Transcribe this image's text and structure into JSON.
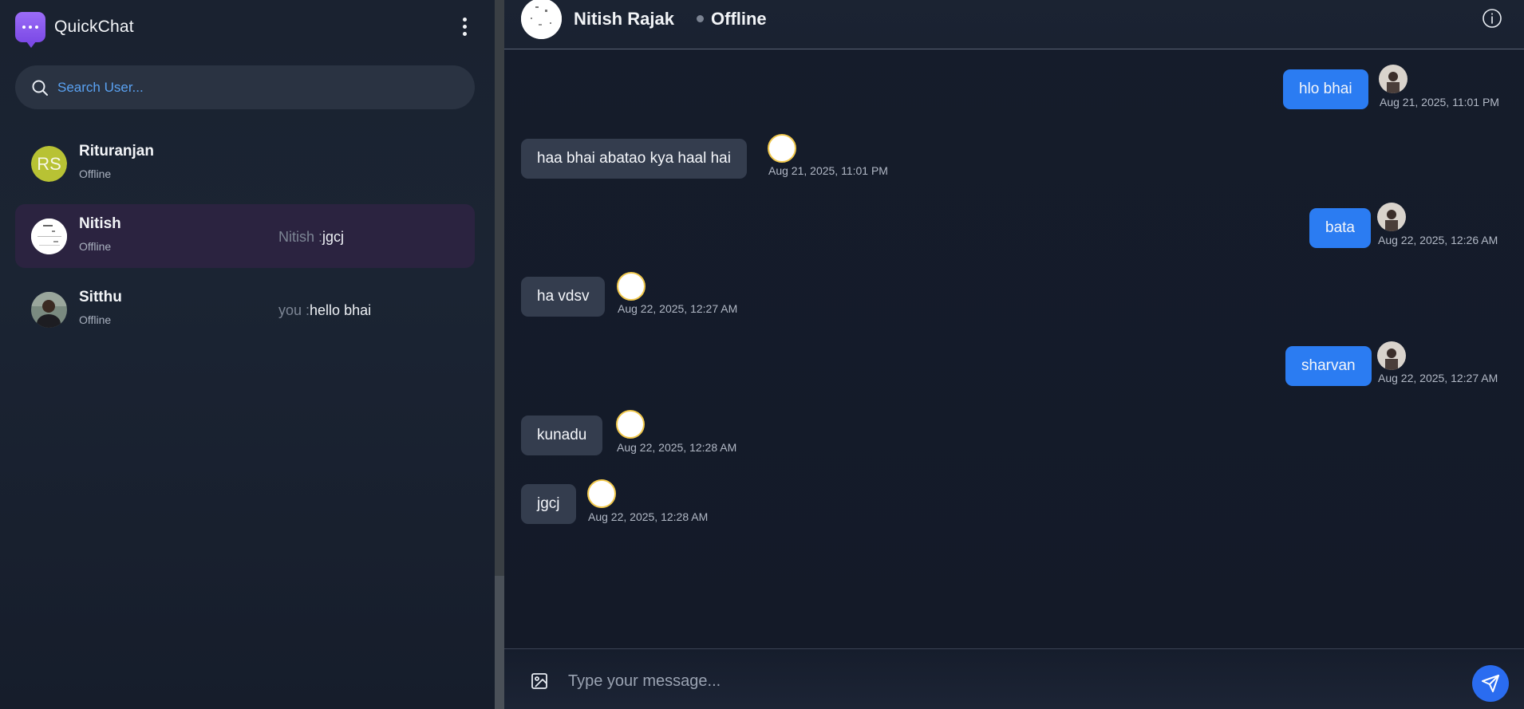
{
  "app": {
    "name": "QuickChat"
  },
  "search": {
    "placeholder": "Search User..."
  },
  "users": [
    {
      "name": "Rituranjan",
      "initials": "RS",
      "status": "Offline",
      "last_from": "",
      "last_msg": ""
    },
    {
      "name": "Nitish",
      "status": "Offline",
      "last_from": "Nitish :",
      "last_msg": "jgcj"
    },
    {
      "name": "Sitthu",
      "status": "Offline",
      "last_from": "you :",
      "last_msg": "hello bhai"
    }
  ],
  "chat": {
    "contact_name": "Nitish Rajak",
    "contact_status": "Offline",
    "messages": [
      {
        "direction": "out",
        "text": "hlo bhai",
        "time": "Aug 21, 2025, 11:01 PM"
      },
      {
        "direction": "in",
        "text": "haa bhai abatao kya haal hai",
        "time": "Aug 21, 2025, 11:01 PM"
      },
      {
        "direction": "out",
        "text": "bata",
        "time": "Aug 22, 2025, 12:26 AM"
      },
      {
        "direction": "in",
        "text": "ha vdsv",
        "time": "Aug 22, 2025, 12:27 AM"
      },
      {
        "direction": "out",
        "text": "sharvan",
        "time": "Aug 22, 2025, 12:27 AM"
      },
      {
        "direction": "in",
        "text": "kunadu",
        "time": "Aug 22, 2025, 12:28 AM"
      },
      {
        "direction": "in",
        "text": "jgcj",
        "time": "Aug 22, 2025, 12:28 AM"
      }
    ]
  },
  "composer": {
    "placeholder": "Type your message..."
  },
  "colors": {
    "accent": "#2b7cf2",
    "brand": "#8b5cf6",
    "sidebar_active": "#2b2340",
    "incoming_bubble": "#343d4e"
  },
  "icons": [
    "chat-bubble-logo-icon",
    "more-vertical-icon",
    "search-icon",
    "info-icon",
    "image-icon",
    "send-icon"
  ]
}
